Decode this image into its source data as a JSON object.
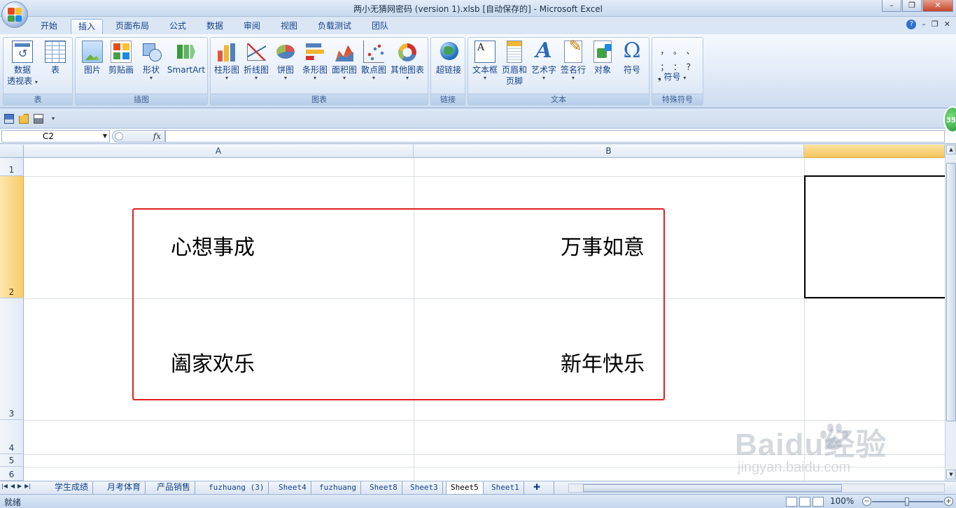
{
  "window": {
    "title": "两小无猜网密码 (version 1).xlsb [自动保存的] - Microsoft Excel",
    "minimize": "–",
    "restore": "❐",
    "close": "✕"
  },
  "tabs": [
    "开始",
    "插入",
    "页面布局",
    "公式",
    "数据",
    "审阅",
    "视图",
    "负载测试",
    "团队"
  ],
  "active_tab": "插入",
  "ribbon": {
    "groups": {
      "table": "表",
      "illustrations": "插图",
      "charts": "图表",
      "links": "链接",
      "text": "文本",
      "special_symbols": "特殊符号"
    },
    "buttons": {
      "pivot_line1": "数据",
      "pivot_line2": "透视表",
      "table": "表",
      "picture": "图片",
      "clipart": "剪贴画",
      "shapes": "形状",
      "smartart": "SmartArt",
      "column": "柱形图",
      "line": "折线图",
      "pie": "饼图",
      "bar": "条形图",
      "area": "面积图",
      "scatter": "散点图",
      "other": "其他图表",
      "hyperlink": "超链接",
      "textbox": "文本框",
      "header_line1": "页眉和",
      "header_line2": "页脚",
      "wordart": "艺术字",
      "signature": "签名行",
      "object": "对象",
      "symbol": "符号",
      "symbol2": "符号"
    },
    "special_chars": [
      "，",
      "。",
      "、",
      "；",
      "：",
      "？"
    ]
  },
  "badge": "35",
  "formula_bar": {
    "name_box": "C2",
    "fx": "fx",
    "formula": ""
  },
  "columns": [
    "A",
    "B",
    ""
  ],
  "rows": [
    "1",
    "2",
    "3",
    "4",
    "5",
    "6"
  ],
  "cells": {
    "A2": "心想事成",
    "B2": "万事如意",
    "A3": "阖家欢乐",
    "B3": "新年快乐"
  },
  "sheet_tabs": [
    "学生成绩",
    "月考体育",
    "产品销售",
    "fuzhuang (3)",
    "Sheet4",
    "fuzhuang",
    "Sheet8",
    "Sheet3",
    "Sheet5",
    "Sheet1"
  ],
  "active_sheet": "Sheet5",
  "status": {
    "ready": "就绪",
    "zoom": "100%",
    "zoom_level_percent": 100
  },
  "watermark": {
    "main": "Baidu经验",
    "sub": "jingyan.baidu.com"
  },
  "colors": {
    "annotation_red": "#e02020",
    "selection_orange": "#f5c55c"
  }
}
